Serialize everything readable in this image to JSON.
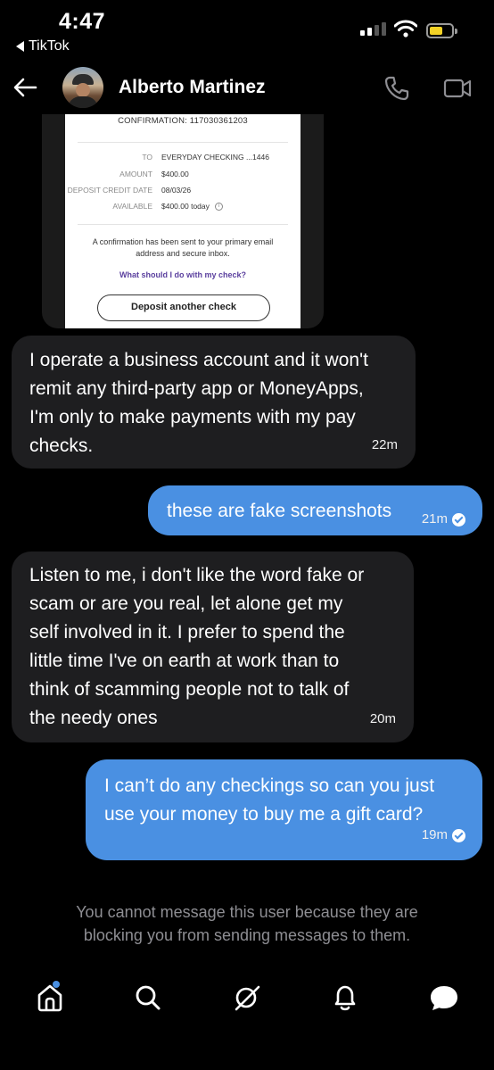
{
  "status_bar": {
    "time": "4:47",
    "back_app": "TikTok"
  },
  "header": {
    "contact_name": "Alberto Martinez"
  },
  "shared_image": {
    "confirmation": "CONFIRMATION: 117030361203",
    "rows": [
      {
        "label": "TO",
        "value": "EVERYDAY CHECKING ...1446"
      },
      {
        "label": "AMOUNT",
        "value": "$400.00"
      },
      {
        "label": "DEPOSIT CREDIT DATE",
        "value": "08/03/26"
      },
      {
        "label": "AVAILABLE",
        "value": "$400.00 today"
      }
    ],
    "info_symbol": "i",
    "note": "A confirmation has been sent to your primary email address and secure inbox.",
    "link": "What should I do with my check?",
    "button": "Deposit another check"
  },
  "messages": [
    {
      "direction": "in",
      "text": "I operate a business account and it won't\nremit any third-party app or MoneyApps,\nI'm only to make payments with my pay\nchecks.",
      "time": "22m"
    },
    {
      "direction": "out",
      "text": "these are fake screenshots",
      "time": "21m"
    },
    {
      "direction": "in",
      "text": "Listen to me, i don't like the word fake or\nscam or are you real, let alone get my\nself involved in it. I prefer to spend the\nlittle time I've on earth at work than to\nthink of scamming people not to talk of\nthe needy ones",
      "time": "20m"
    },
    {
      "direction": "out",
      "text": "I can’t do any checkings so can you just\nuse your money to buy me a gift card?",
      "time": "19m"
    }
  ],
  "blocked_notice": "You cannot message this user because they are\nblocking you from sending messages to them.",
  "tab_bar": {
    "icons": [
      "home-icon",
      "search-icon",
      "grok-icon",
      "notifications-icon",
      "messages-icon"
    ],
    "accent_color": "#4a90e2"
  },
  "colors": {
    "background": "#000000",
    "incoming_bubble": "#1e1e20",
    "outgoing_bubble": "#4a90e2",
    "muted_text": "#8e8e93"
  }
}
